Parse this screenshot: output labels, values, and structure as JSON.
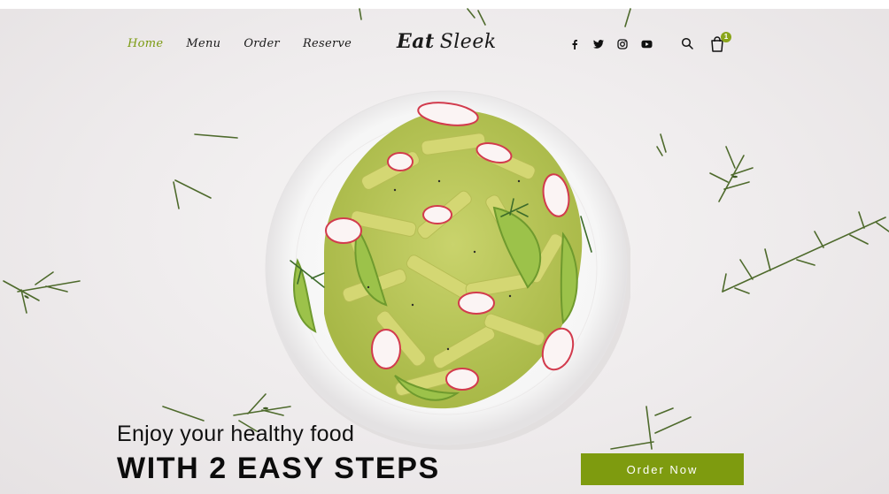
{
  "nav": {
    "items": [
      {
        "label": "Home",
        "active": true
      },
      {
        "label": "Menu",
        "active": false
      },
      {
        "label": "Order",
        "active": false
      },
      {
        "label": "Reserve",
        "active": false
      }
    ]
  },
  "brand": {
    "bold": "Eat",
    "light": "Sleek"
  },
  "social": {
    "icons": [
      "facebook-icon",
      "twitter-icon",
      "instagram-icon",
      "youtube-icon"
    ]
  },
  "header_actions": {
    "search_icon": "search-icon",
    "cart_icon": "shopping-bag-icon",
    "cart_count": "1"
  },
  "hero": {
    "tagline": "Enjoy your healthy food",
    "headline": "WITH 2 EASY STEPS",
    "cta_label": "Order Now",
    "image": "penne-pasta-plate"
  },
  "colors": {
    "accent": "#7e9b0f",
    "active_nav": "#7a9a10",
    "text": "#1a1a1a",
    "background": "#eeebec"
  }
}
